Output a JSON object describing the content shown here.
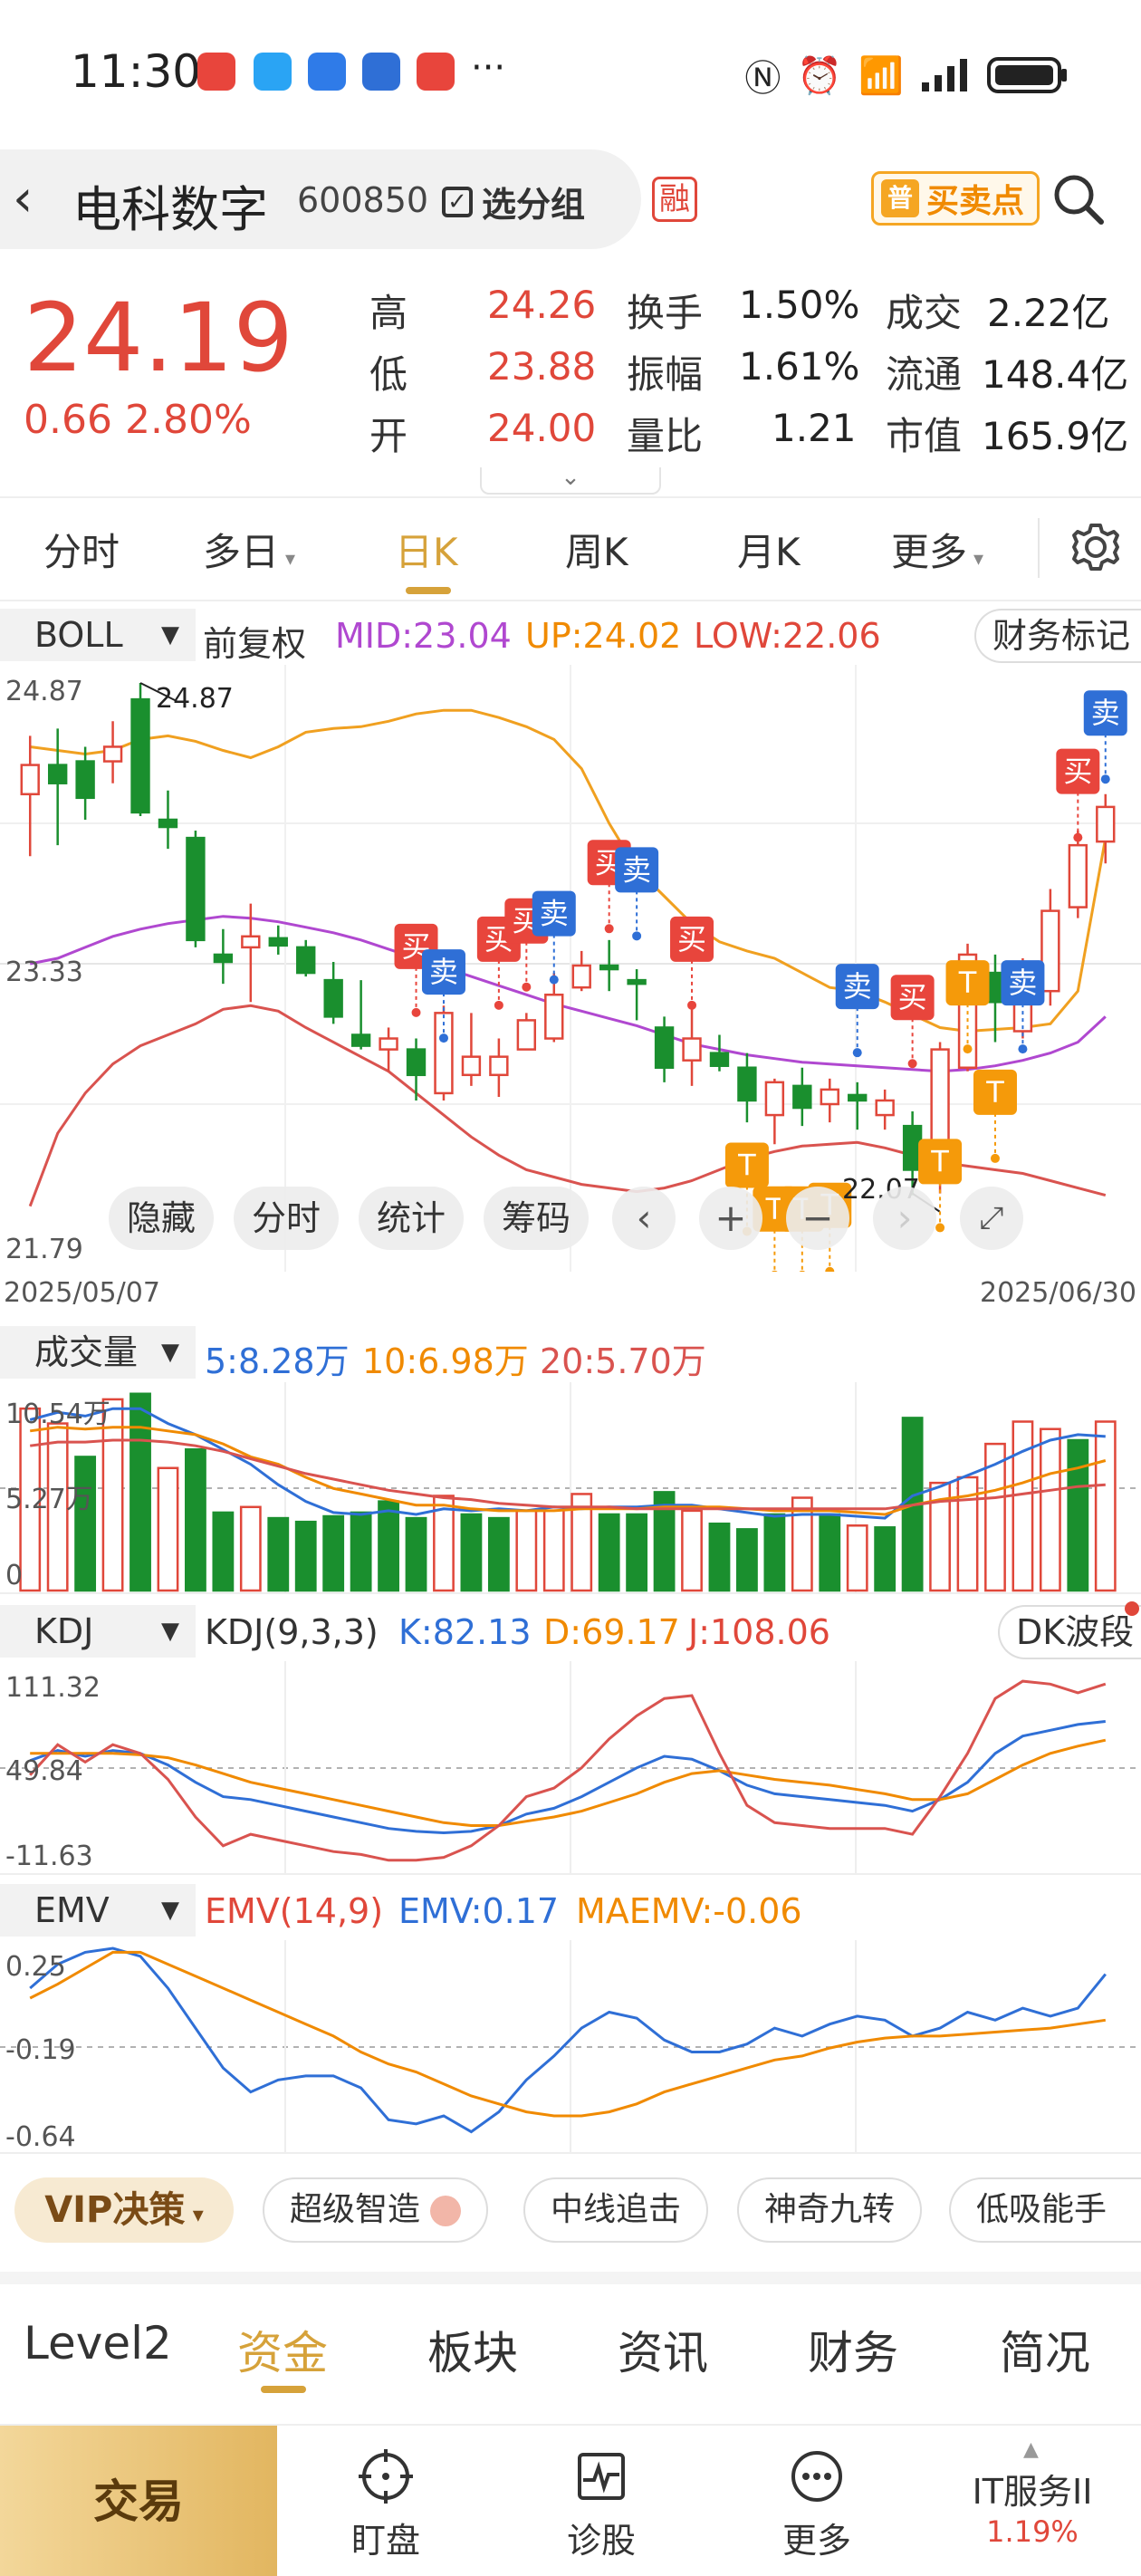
{
  "status_bar": {
    "time": "11:30",
    "more_dots": "···"
  },
  "header": {
    "stock_name": "电科数字",
    "stock_code": "600850",
    "group_label": "选分组",
    "rong_badge": "融",
    "buysell_label": "买卖点",
    "buysell_icon_text": "普"
  },
  "quote": {
    "price": "24.19",
    "change": "0.66",
    "change_pct": "2.80%",
    "high_label": "高",
    "high": "24.26",
    "low_label": "低",
    "low": "23.88",
    "open_label": "开",
    "open": "24.00",
    "turnover_label": "换手",
    "turnover": "1.50%",
    "amplitude_label": "振幅",
    "amplitude": "1.61%",
    "volratio_label": "量比",
    "volratio": "1.21",
    "amount_label": "成交",
    "amount": "2.22亿",
    "float_label": "流通",
    "float_cap": "148.4亿",
    "mktcap_label": "市值",
    "mkt_cap": "165.9亿"
  },
  "period_tabs": {
    "intraday": "分时",
    "multiday": "多日",
    "day": "日K",
    "week": "周K",
    "month": "月K",
    "more": "更多"
  },
  "boll": {
    "selector": "BOLL",
    "adjust": "前复权",
    "mid": "MID:23.04",
    "up": "UP:24.02",
    "low": "LOW:22.06",
    "finance_btn": "财务标记",
    "axis_top": "24.87",
    "axis_mid": "23.33",
    "axis_bottom": "21.79",
    "high_annot": "24.87",
    "low_annot": "22.07"
  },
  "chart_overlay": {
    "hide": "隐藏",
    "intraday": "分时",
    "stats": "统计",
    "chips": "筹码"
  },
  "dates": {
    "start": "2025/05/07",
    "end": "2025/06/30"
  },
  "signals": {
    "buy": "买",
    "sell": "卖",
    "t": "T"
  },
  "volume": {
    "selector": "成交量",
    "ma5": "5:8.28万",
    "ma10": "10:6.98万",
    "ma20": "20:5.70万",
    "axis_top": "10.54万",
    "axis_mid": "5.27万",
    "axis_bottom": "0"
  },
  "kdj": {
    "selector": "KDJ",
    "params": "KDJ(9,3,3)",
    "k": "K:82.13",
    "d": "D:69.17",
    "j": "J:108.06",
    "dk_btn": "DK波段",
    "axis_top": "111.32",
    "axis_mid": "49.84",
    "axis_bottom": "-11.63"
  },
  "emv": {
    "selector": "EMV",
    "params": "EMV(14,9)",
    "emv": "EMV:0.17",
    "maemv": "MAEMV:-0.06",
    "axis_top": "0.25",
    "axis_mid": "-0.19",
    "axis_bottom": "-0.64"
  },
  "vip": {
    "label": "VIP决策",
    "strategies": [
      "超级智造",
      "中线追击",
      "神奇九转",
      "低吸能手"
    ]
  },
  "bottom_tabs": [
    "Level2",
    "资金",
    "板块",
    "资讯",
    "财务",
    "简况"
  ],
  "toolbar": {
    "trade": "交易",
    "watch": "盯盘",
    "diagnose": "诊股",
    "more": "更多",
    "sector_name": "IT服务II",
    "sector_pct": "1.19%"
  },
  "colors": {
    "up": "#e0473a",
    "down": "#1a8f2e",
    "accent": "#d6a23a",
    "boll_mid": "#b048d0",
    "boll_up": "#f0a020",
    "boll_low": "#d9534f"
  },
  "chart_data": [
    {
      "type": "candlestick",
      "name": "BOLL",
      "ylim": [
        21.79,
        24.87
      ],
      "x_start": "2025/05/07",
      "x_end": "2025/06/30",
      "ohlc": [
        [
          24.26,
          24.58,
          23.92,
          24.42
        ],
        [
          24.42,
          24.62,
          23.98,
          24.32
        ],
        [
          24.44,
          24.52,
          24.12,
          24.24
        ],
        [
          24.44,
          24.66,
          24.32,
          24.52
        ],
        [
          24.78,
          24.87,
          24.14,
          24.16
        ],
        [
          24.12,
          24.28,
          23.96,
          24.08
        ],
        [
          24.02,
          24.06,
          23.42,
          23.46
        ],
        [
          23.38,
          23.52,
          23.22,
          23.34
        ],
        [
          23.42,
          23.66,
          23.12,
          23.48
        ],
        [
          23.47,
          23.54,
          23.38,
          23.43
        ],
        [
          23.42,
          23.46,
          23.26,
          23.28
        ],
        [
          23.24,
          23.34,
          23.0,
          23.04
        ],
        [
          22.94,
          23.24,
          22.86,
          22.88
        ],
        [
          22.86,
          22.98,
          22.74,
          22.92
        ],
        [
          22.86,
          22.92,
          22.58,
          22.72
        ],
        [
          22.62,
          23.1,
          22.58,
          23.06
        ],
        [
          22.72,
          23.06,
          22.66,
          22.82
        ],
        [
          22.72,
          22.92,
          22.6,
          22.82
        ],
        [
          22.86,
          23.06,
          22.86,
          23.02
        ],
        [
          22.92,
          23.28,
          22.9,
          23.16
        ],
        [
          23.2,
          23.4,
          23.18,
          23.32
        ],
        [
          23.32,
          23.46,
          23.18,
          23.3
        ],
        [
          23.24,
          23.3,
          23.02,
          23.22
        ],
        [
          22.98,
          23.04,
          22.68,
          22.76
        ],
        [
          22.8,
          23.1,
          22.66,
          22.92
        ],
        [
          22.84,
          22.94,
          22.74,
          22.77
        ],
        [
          22.76,
          22.84,
          22.46,
          22.58
        ],
        [
          22.5,
          22.7,
          22.34,
          22.68
        ],
        [
          22.66,
          22.76,
          22.44,
          22.54
        ],
        [
          22.56,
          22.7,
          22.46,
          22.64
        ],
        [
          22.61,
          22.68,
          22.42,
          22.58
        ],
        [
          22.5,
          22.64,
          22.42,
          22.58
        ],
        [
          22.44,
          22.52,
          22.06,
          22.2
        ],
        [
          22.2,
          22.9,
          22.07,
          22.86
        ],
        [
          22.76,
          23.44,
          22.74,
          23.38
        ],
        [
          23.28,
          23.38,
          22.9,
          23.12
        ],
        [
          22.96,
          23.36,
          22.92,
          23.28
        ],
        [
          23.18,
          23.74,
          23.1,
          23.62
        ],
        [
          23.64,
          24.06,
          23.58,
          23.98
        ],
        [
          24.0,
          24.26,
          23.88,
          24.19
        ]
      ],
      "series": [
        {
          "name": "MID",
          "values": [
            23.33,
            23.36,
            23.42,
            23.48,
            23.52,
            23.55,
            23.57,
            23.59,
            23.58,
            23.56,
            23.53,
            23.5,
            23.46,
            23.41,
            23.36,
            23.31,
            23.26,
            23.21,
            23.16,
            23.11,
            23.07,
            23.03,
            22.99,
            22.94,
            22.89,
            22.86,
            22.83,
            22.81,
            22.79,
            22.78,
            22.77,
            22.76,
            22.75,
            22.74,
            22.75,
            22.77,
            22.8,
            22.84,
            22.9,
            23.04
          ]
        },
        {
          "name": "UP",
          "values": [
            24.52,
            24.5,
            24.48,
            24.5,
            24.56,
            24.58,
            24.55,
            24.5,
            24.46,
            24.52,
            24.6,
            24.62,
            24.63,
            24.66,
            24.7,
            24.72,
            24.72,
            24.68,
            24.63,
            24.56,
            24.4,
            24.1,
            23.85,
            23.7,
            23.55,
            23.45,
            23.4,
            23.36,
            23.28,
            23.2,
            23.18,
            23.12,
            23.05,
            22.98,
            22.96,
            22.97,
            22.98,
            23.0,
            23.18,
            24.02
          ]
        },
        {
          "name": "LOW",
          "values": [
            22.0,
            22.4,
            22.62,
            22.78,
            22.88,
            22.94,
            23.0,
            23.08,
            23.1,
            23.07,
            22.98,
            22.9,
            22.82,
            22.74,
            22.62,
            22.5,
            22.38,
            22.28,
            22.2,
            22.16,
            22.12,
            22.1,
            22.08,
            22.1,
            22.14,
            22.2,
            22.26,
            22.3,
            22.33,
            22.34,
            22.35,
            22.32,
            22.28,
            22.24,
            22.22,
            22.2,
            22.18,
            22.14,
            22.1,
            22.06
          ]
        }
      ]
    },
    {
      "type": "bar",
      "name": "成交量",
      "ylim": [
        0,
        10.54
      ],
      "values": [
        9.8,
        9.0,
        7.2,
        10.3,
        10.6,
        6.6,
        7.6,
        4.2,
        4.5,
        3.9,
        3.7,
        4.0,
        4.2,
        4.8,
        3.9,
        5.1,
        4.1,
        3.9,
        4.3,
        4.5,
        5.2,
        4.1,
        4.1,
        5.3,
        4.3,
        3.6,
        3.3,
        4.1,
        5.0,
        4.1,
        3.5,
        3.4,
        9.3,
        5.8,
        6.1,
        7.9,
        9.1,
        8.7,
        8.1,
        9.1
      ],
      "up": [
        1,
        1,
        0,
        1,
        0,
        1,
        0,
        0,
        1,
        0,
        0,
        0,
        0,
        0,
        0,
        1,
        0,
        0,
        1,
        1,
        1,
        0,
        0,
        0,
        1,
        0,
        0,
        0,
        1,
        0,
        1,
        0,
        0,
        1,
        1,
        1,
        1,
        1,
        0,
        1
      ],
      "series": [
        {
          "name": "MA5",
          "values": [
            9.2,
            9.6,
            9.4,
            9.8,
            9.8,
            9.0,
            8.4,
            7.6,
            6.8,
            5.7,
            4.8,
            4.2,
            4.1,
            4.3,
            4.1,
            4.4,
            4.3,
            4.4,
            4.3,
            4.5,
            4.4,
            4.5,
            4.5,
            4.6,
            4.6,
            4.4,
            4.2,
            4.0,
            4.1,
            4.1,
            4.0,
            3.9,
            5.1,
            5.6,
            6.2,
            6.8,
            7.5,
            8.1,
            8.4,
            8.3
          ]
        },
        {
          "name": "MA10",
          "values": [
            8.6,
            8.8,
            8.7,
            8.8,
            8.8,
            8.6,
            8.4,
            7.9,
            7.2,
            6.8,
            6.1,
            5.5,
            5.2,
            4.9,
            4.6,
            4.6,
            4.4,
            4.3,
            4.3,
            4.3,
            4.4,
            4.4,
            4.4,
            4.5,
            4.5,
            4.5,
            4.4,
            4.3,
            4.3,
            4.3,
            4.2,
            4.1,
            4.6,
            4.9,
            5.1,
            5.4,
            5.8,
            6.3,
            6.6,
            7.0
          ]
        },
        {
          "name": "MA20",
          "values": [
            7.8,
            8.0,
            8.0,
            8.1,
            8.1,
            8.0,
            7.8,
            7.5,
            7.1,
            6.7,
            6.3,
            6.0,
            5.7,
            5.4,
            5.2,
            5.0,
            4.9,
            4.7,
            4.6,
            4.5,
            4.5,
            4.5,
            4.4,
            4.4,
            4.4,
            4.4,
            4.4,
            4.4,
            4.4,
            4.4,
            4.4,
            4.4,
            4.6,
            4.8,
            4.9,
            5.0,
            5.2,
            5.4,
            5.6,
            5.7
          ]
        }
      ]
    },
    {
      "type": "line",
      "name": "KDJ",
      "ylim": [
        -11.63,
        111.32
      ],
      "series": [
        {
          "name": "K",
          "values": [
            55,
            62,
            58,
            62,
            60,
            52,
            40,
            30,
            28,
            24,
            20,
            16,
            12,
            8,
            6,
            5,
            6,
            10,
            18,
            22,
            30,
            40,
            50,
            58,
            56,
            48,
            38,
            32,
            30,
            28,
            26,
            24,
            20,
            28,
            40,
            60,
            72,
            76,
            80,
            82.13
          ]
        },
        {
          "name": "D",
          "values": [
            60,
            60,
            60,
            60,
            59,
            57,
            52,
            46,
            40,
            36,
            32,
            28,
            24,
            20,
            16,
            12,
            10,
            10,
            13,
            16,
            20,
            26,
            32,
            40,
            46,
            48,
            45,
            42,
            40,
            38,
            35,
            32,
            28,
            28,
            32,
            42,
            52,
            60,
            65,
            69.17
          ]
        },
        {
          "name": "J",
          "values": [
            45,
            66,
            54,
            66,
            60,
            42,
            16,
            -4,
            4,
            0,
            -4,
            -8,
            -10,
            -14,
            -14,
            -12,
            -4,
            10,
            30,
            36,
            50,
            70,
            86,
            98,
            100,
            60,
            24,
            12,
            10,
            8,
            8,
            8,
            4,
            30,
            60,
            98,
            110,
            108,
            102,
            108.06
          ]
        }
      ]
    },
    {
      "type": "line",
      "name": "EMV",
      "ylim": [
        -0.64,
        0.25
      ],
      "series": [
        {
          "name": "EMV",
          "values": [
            0.1,
            0.22,
            0.28,
            0.3,
            0.26,
            0.1,
            -0.1,
            -0.3,
            -0.42,
            -0.36,
            -0.34,
            -0.34,
            -0.4,
            -0.56,
            -0.58,
            -0.54,
            -0.62,
            -0.52,
            -0.36,
            -0.24,
            -0.1,
            -0.02,
            -0.05,
            -0.16,
            -0.22,
            -0.22,
            -0.18,
            -0.1,
            -0.14,
            -0.08,
            -0.04,
            -0.06,
            -0.14,
            -0.1,
            -0.02,
            -0.06,
            0.0,
            -0.04,
            0.0,
            0.17
          ]
        },
        {
          "name": "MAEMV",
          "values": [
            0.05,
            0.12,
            0.2,
            0.28,
            0.28,
            0.22,
            0.16,
            0.1,
            0.04,
            -0.02,
            -0.08,
            -0.14,
            -0.22,
            -0.28,
            -0.32,
            -0.38,
            -0.44,
            -0.48,
            -0.52,
            -0.54,
            -0.54,
            -0.52,
            -0.48,
            -0.42,
            -0.38,
            -0.34,
            -0.3,
            -0.26,
            -0.24,
            -0.2,
            -0.17,
            -0.15,
            -0.14,
            -0.14,
            -0.13,
            -0.12,
            -0.11,
            -0.1,
            -0.08,
            -0.06
          ]
        }
      ]
    }
  ]
}
